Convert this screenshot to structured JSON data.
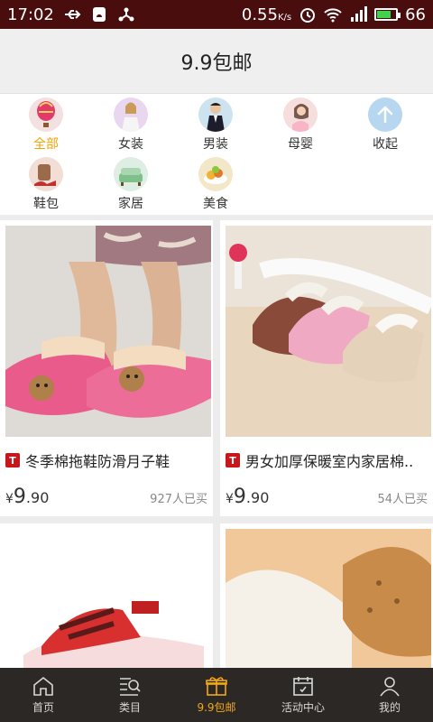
{
  "status": {
    "time": "17:02",
    "speed": "0.55",
    "speed_unit": "K/s",
    "battery": "66",
    "battery_fraction": 0.66
  },
  "header": {
    "title": "9.9包邮"
  },
  "categories": [
    {
      "label": "全部",
      "icon": "all-balloon-icon",
      "active": true
    },
    {
      "label": "女装",
      "icon": "womens-clothing-icon"
    },
    {
      "label": "男装",
      "icon": "mens-clothing-icon"
    },
    {
      "label": "母婴",
      "icon": "mother-baby-icon"
    },
    {
      "label": "收起",
      "icon": "collapse-arrow-icon"
    },
    {
      "label": "鞋包",
      "icon": "shoes-bags-icon"
    },
    {
      "label": "家居",
      "icon": "home-living-icon"
    },
    {
      "label": "美食",
      "icon": "food-icon"
    }
  ],
  "products": [
    {
      "title": "冬季棉拖鞋防滑月子鞋",
      "price_int": "9",
      "price_dec": ".90",
      "currency": "¥",
      "sold": "927人已买",
      "badge": "T"
    },
    {
      "title": "男女加厚保暖室内家居棉..",
      "price_int": "9",
      "price_dec": ".90",
      "currency": "¥",
      "sold": "54人已买",
      "badge": "T"
    },
    {
      "title": "",
      "price_int": "",
      "price_dec": "",
      "currency": "",
      "sold": "",
      "badge": ""
    },
    {
      "title": "",
      "price_int": "",
      "price_dec": "",
      "currency": "",
      "sold": "",
      "badge": ""
    }
  ],
  "bottom_nav": [
    {
      "label": "首页",
      "icon": "home-icon"
    },
    {
      "label": "类目",
      "icon": "category-search-icon"
    },
    {
      "label": "9.9包邮",
      "icon": "gift-box-icon",
      "active": true
    },
    {
      "label": "活动中心",
      "icon": "calendar-icon"
    },
    {
      "label": "我的",
      "icon": "user-icon"
    }
  ],
  "colors": {
    "accent": "#f3a814",
    "statusbar": "#4a0d0d",
    "badge": "#c8161d",
    "nav_bg": "#2b2825"
  }
}
